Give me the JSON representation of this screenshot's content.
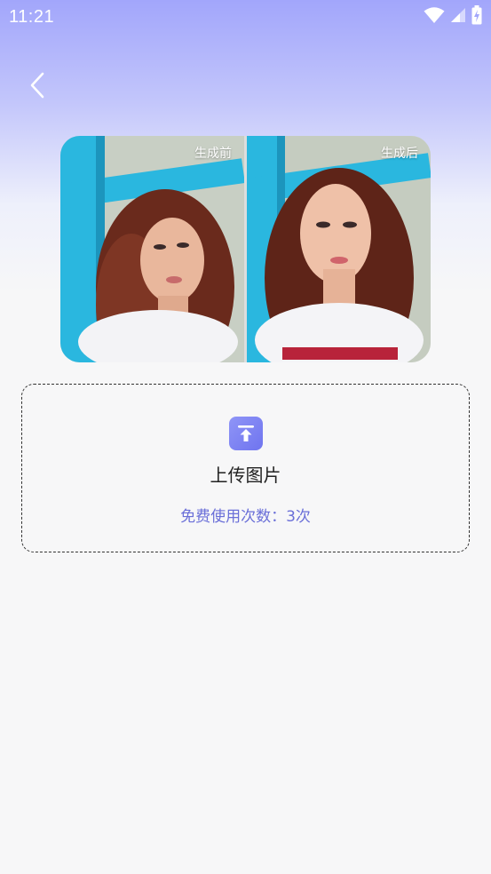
{
  "status_bar": {
    "time": "11:21",
    "icons": [
      "wifi-icon",
      "signal-icon",
      "battery-charging-icon"
    ]
  },
  "header": {
    "back_icon": "chevron-left-icon"
  },
  "comparison": {
    "before_label": "生成前",
    "after_label": "生成后"
  },
  "upload": {
    "icon": "upload-icon",
    "title": "上传图片",
    "free_uses": "免费使用次数：3次"
  },
  "colors": {
    "gradient_top": "#a2a6fb",
    "background": "#f7f7f8",
    "accent": "#6a6fd8",
    "icon_gradient": [
      "#8f95f7",
      "#6f74ef"
    ]
  }
}
